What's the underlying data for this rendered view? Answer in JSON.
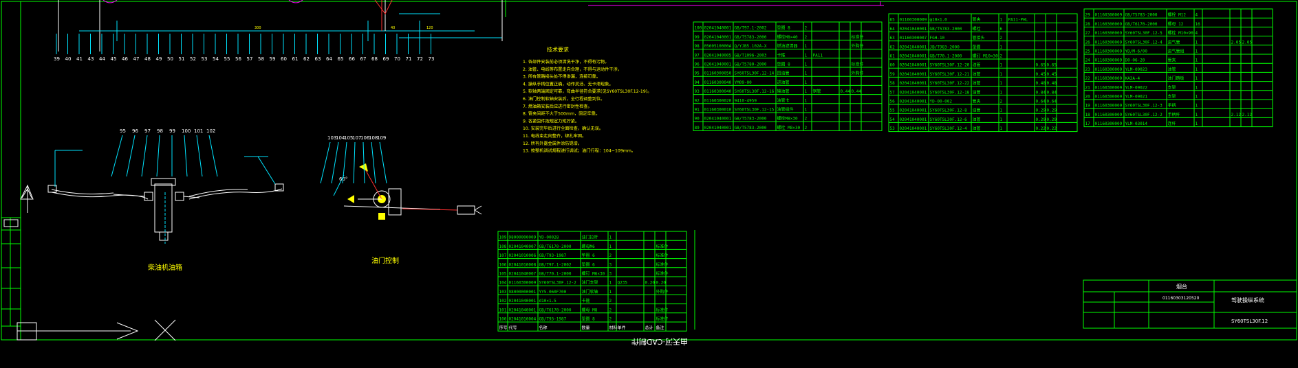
{
  "title_block": {
    "company": "烟台",
    "drawing_no": "01160303120520",
    "name": "驾驶操纵系统",
    "code": "SY60TSL30F.12",
    "watermark": "由天河·CAD制作"
  },
  "views": {
    "left_caption": "柴油机油箱",
    "right_caption": "油门控制",
    "angle_label": "60°"
  },
  "balloons_top": [
    "39",
    "40",
    "41",
    "43",
    "44",
    "45",
    "46",
    "47",
    "48",
    "49",
    "50",
    "51",
    "52",
    "53",
    "54",
    "55",
    "56",
    "57",
    "58",
    "59",
    "60",
    "61",
    "62",
    "63",
    "64",
    "65",
    "66",
    "67",
    "68",
    "69",
    "70",
    "71",
    "72",
    "73"
  ],
  "balloons_left": [
    "95",
    "96",
    "97",
    "98",
    "99",
    "100",
    "101",
    "102"
  ],
  "balloons_right": [
    "103",
    "104",
    "105",
    "107",
    "106",
    "108",
    "109"
  ],
  "tech_notes": {
    "heading": "技术要求",
    "lines": [
      "1. 各部件安装前必须清洗干净，不得有污物。",
      "2. 油管、电线等布置走向合理，不得与运动件干涉。",
      "3. 所有管路接头处不得渗漏，连接可靠。",
      "4. 操纵手柄位置正确，动作灵活、无卡滞现象。",
      "5. 软轴两端固定可靠，弯曲半径符合要求(见SY60TSL30F.12-19)。",
      "6. 油门控制软轴安装后，全行程调整到位。",
      "7. 燃油箱安装后应进行密封性检查。",
      "8. 管夹间距不大于500mm，固定牢靠。",
      "9. 各紧固件按规定力矩拧紧。",
      "10. 安装完毕后进行全面检查，确认无误。",
      "11. 电线束走向整齐，绑扎牢固。",
      "12. 所有外露金属件涂防锈漆。",
      "13. 按整机调试规程进行调试；油门行程：104~109mm。"
    ]
  },
  "column_headers": [
    "序号",
    "代号",
    "名称",
    "数量",
    "材料",
    "单件",
    "总计",
    "备注"
  ],
  "bom_a": [
    [
      "109",
      "98000000009",
      "YD-00028",
      "油门拉杆",
      "1",
      "",
      "",
      ""
    ],
    [
      "108",
      "02041040007",
      "GB/T6170-2000",
      "螺母M6",
      "1",
      "",
      "",
      "标准件"
    ],
    [
      "107",
      "02041010006",
      "GB/T93-1987",
      "垫圈 6",
      "2",
      "",
      "",
      "标准件"
    ],
    [
      "106",
      "02041010008",
      "GB/T97.1-2002",
      "垫圈 6",
      "3",
      "",
      "",
      "标准件"
    ],
    [
      "105",
      "02041040007",
      "GB/T70.1-2000",
      "螺钉 M6×30",
      "3",
      "",
      "",
      "标准件"
    ],
    [
      "104",
      "01160300009",
      "SY60TSL30F.12-2",
      "油门支架",
      "1",
      "Q235",
      "0.20",
      "0.20"
    ],
    [
      "103",
      "98000000001",
      "YY5-060F700",
      "油门软轴",
      "1",
      "",
      "",
      "外购件"
    ],
    [
      "102",
      "02041040001",
      "d10×1.5",
      "卡箍",
      "2",
      "",
      "",
      ""
    ],
    [
      "101",
      "02041040001",
      "GB/T6170-2000",
      "螺母 M8",
      "2",
      "",
      "",
      "标准件"
    ],
    [
      "100",
      "02041010004",
      "GB/T93-1987",
      "垫圈 8",
      "2",
      "",
      "",
      "标准件"
    ]
  ],
  "bom_b": [
    [
      "100",
      "02041040001",
      "GB/T97.1-2002",
      "垫圈 8",
      "2",
      "",
      "",
      ""
    ],
    [
      "99",
      "02041040001",
      "GB/T5783-2000",
      "螺栓M8×40",
      "2",
      "",
      "",
      "标准件"
    ],
    [
      "98",
      "0560510000A",
      "Q/YJB5.102A-X",
      "燃油滤清器",
      "1",
      "",
      "",
      "外购件"
    ],
    [
      "97",
      "02041040005",
      "GB/T1096-2003",
      "卡箍",
      "1",
      "PA11",
      "",
      ""
    ],
    [
      "96",
      "02041040001",
      "GB/T5780-2000",
      "垫圈 8",
      "1",
      "",
      "",
      "标准件"
    ],
    [
      "95",
      "01160300050",
      "SY60TSL30F.12-14",
      "回油管",
      "1",
      "",
      "",
      "外购件"
    ],
    [
      "94",
      "01160300040",
      "YM09-00",
      "进油管",
      "1",
      "",
      "",
      ""
    ],
    [
      "93",
      "01160300040",
      "SY60TSL30F.12-16",
      "输油管",
      "1",
      "钢管",
      "0.44",
      "0.44"
    ],
    [
      "92",
      "01160300020",
      "9410-4959",
      "油管卡",
      "1",
      "",
      "",
      ""
    ],
    [
      "91",
      "01160300010",
      "SY60TSL30F.12-15",
      "油管组件",
      "1",
      "",
      "",
      ""
    ],
    [
      "90",
      "02041040001",
      "GB/T5783-2000",
      "螺栓M8×30",
      "2",
      "",
      "",
      ""
    ],
    [
      "89",
      "02041040001",
      "GB/T5783-2000",
      "螺栓 M8×30",
      "2",
      "",
      "",
      ""
    ]
  ],
  "bom_c": [
    [
      "65",
      "01160300009",
      "φ10×1.0",
      "管夹",
      "1",
      "PA11-PHL",
      "",
      ""
    ],
    [
      "64",
      "02041040001",
      "GB/T5783-2000",
      "螺栓",
      "6",
      "",
      "",
      ""
    ],
    [
      "63",
      "01160300007",
      "FGH-10",
      "管接头",
      "2",
      "",
      "",
      ""
    ],
    [
      "62",
      "02041040001",
      "JB/T983-2000",
      "垫圈",
      "1",
      "",
      "",
      ""
    ],
    [
      "61",
      "02041040001",
      "GB/T70.1-2000",
      "螺钉 M10×30",
      "2",
      "",
      "",
      ""
    ],
    [
      "60",
      "02041040001",
      "SY60TSL30F.12-20",
      "油管",
      "1",
      "",
      "0.65",
      "0.65"
    ],
    [
      "59",
      "02041040001",
      "SY60TSL30F.12-21",
      "油管",
      "1",
      "",
      "0.45",
      "0.45"
    ],
    [
      "58",
      "02041040001",
      "SY60TSL30F.12-22",
      "油管",
      "1",
      "",
      "0.48",
      "0.48"
    ],
    [
      "57",
      "02041040001",
      "SY60TSL30F.12-18",
      "油管",
      "1",
      "",
      "0.84",
      "0.84"
    ],
    [
      "56",
      "02041040001",
      "YD-00-002",
      "管夹",
      "2",
      "",
      "0.64",
      "0.64"
    ],
    [
      "55",
      "02041040001",
      "SY60TSL30F.12-8",
      "油管",
      "1",
      "",
      "0.29",
      "0.29"
    ],
    [
      "54",
      "02041040001",
      "SY60TSL30F.12-6",
      "油管",
      "1",
      "",
      "0.29",
      "0.29"
    ],
    [
      "53",
      "02041040001",
      "SY60TSL30F.12-4",
      "油管",
      "1",
      "",
      "0.22",
      "0.22"
    ]
  ],
  "bom_d": [
    [
      "29",
      "01160300009",
      "GB/T5783-2000",
      "螺栓 M12",
      "4",
      "",
      "",
      ""
    ],
    [
      "28",
      "01160300009",
      "GB/T6170-2000",
      "螺母 12",
      "16",
      "",
      "",
      ""
    ],
    [
      "27",
      "01160300009",
      "SY60TSL30F.12-5",
      "螺栓 M10×90",
      "4",
      "",
      "",
      ""
    ],
    [
      "26",
      "01160300009",
      "SY60TSL30F.12-4",
      "进气管",
      "1",
      "",
      "2.05",
      "2.05"
    ],
    [
      "25",
      "01160300009",
      "YD/M-6/00",
      "进气管组",
      "1",
      "",
      "",
      ""
    ],
    [
      "24",
      "01160300009",
      "D0-06-20",
      "管夹",
      "1",
      "",
      "",
      ""
    ],
    [
      "23",
      "01160300009",
      "YLM-09023",
      "油管",
      "1",
      "",
      "",
      ""
    ],
    [
      "22",
      "01160300009",
      "KA2A-4",
      "油门踏板",
      "1",
      "",
      "",
      ""
    ],
    [
      "21",
      "01160300009",
      "YLM-09022",
      "支架",
      "1",
      "",
      "",
      ""
    ],
    [
      "20",
      "01160300009",
      "YLM-09021",
      "支架",
      "1",
      "",
      "",
      ""
    ],
    [
      "19",
      "01160300009",
      "SY60TSL30F.12-3",
      "手柄",
      "1",
      "",
      "",
      ""
    ],
    [
      "18",
      "01160300009",
      "SY60TSL30F.12-2",
      "手柄杆",
      "1",
      "",
      "2.12",
      "2.12"
    ],
    [
      "17",
      "01160300009",
      "YLM-03014",
      "连杆",
      "1",
      "",
      "",
      ""
    ]
  ]
}
